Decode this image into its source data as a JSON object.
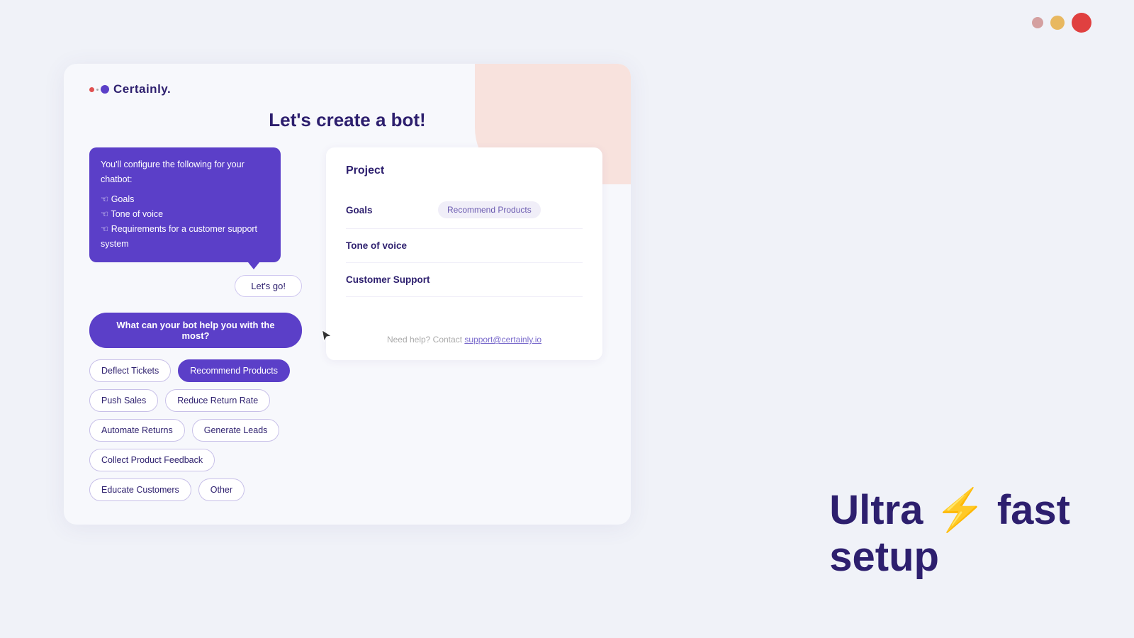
{
  "window_controls": [
    {
      "color": "#d4a0a0",
      "size": 16
    },
    {
      "color": "#e8b860",
      "size": 20
    },
    {
      "color": "#e04040",
      "size": 28
    }
  ],
  "logo": {
    "text": "Certainly."
  },
  "page": {
    "title": "Let's create a bot!"
  },
  "tooltip": {
    "text": "You'll configure the following for your chatbot:",
    "items": [
      "Goals",
      "Tone of voice",
      "Requirements for a customer support system"
    ]
  },
  "lets_go_label": "Let's go!",
  "question_label": "What can your bot help you with the most?",
  "choices": [
    {
      "label": "Deflect Tickets",
      "selected": false
    },
    {
      "label": "Recommend Products",
      "selected": true
    },
    {
      "label": "Push Sales",
      "selected": false
    },
    {
      "label": "Reduce Return Rate",
      "selected": false
    },
    {
      "label": "Automate Returns",
      "selected": false
    },
    {
      "label": "Generate Leads",
      "selected": false
    },
    {
      "label": "Collect Product Feedback",
      "selected": false
    },
    {
      "label": "Educate Customers",
      "selected": false
    },
    {
      "label": "Other",
      "selected": false
    }
  ],
  "project": {
    "title": "Project",
    "rows": [
      {
        "label": "Goals",
        "value": "Recommend Products"
      },
      {
        "label": "Tone of voice",
        "value": ""
      },
      {
        "label": "Customer Support",
        "value": ""
      }
    ]
  },
  "support": {
    "text": "Need help? Contact ",
    "link": "support@certainly.io"
  },
  "tagline": {
    "prefix": "Ultra ",
    "lightning": "⚡",
    "suffix": " fast\nsetup"
  }
}
